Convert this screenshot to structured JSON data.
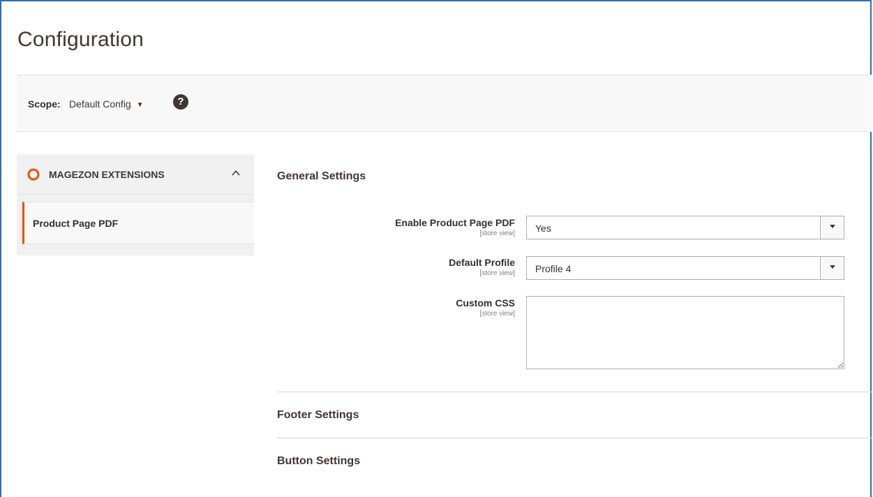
{
  "page": {
    "title": "Configuration"
  },
  "scope": {
    "label": "Scope:",
    "value": "Default Config",
    "help_glyph": "?"
  },
  "sidebar": {
    "group_title": "MAGEZON EXTENSIONS",
    "group_icon": "magezon-logo-icon",
    "items": [
      {
        "label": "Product Page PDF",
        "active": true
      }
    ]
  },
  "sections": {
    "general": {
      "title": "General Settings",
      "fields": {
        "enable": {
          "label": "Enable Product Page PDF",
          "scope_hint": "[store view]",
          "value": "Yes"
        },
        "profile": {
          "label": "Default Profile",
          "scope_hint": "[store view]",
          "value": "Profile 4"
        },
        "custom_css": {
          "label": "Custom CSS",
          "scope_hint": "[store view]",
          "value": ""
        }
      }
    },
    "footer": {
      "title": "Footer Settings"
    },
    "button": {
      "title": "Button Settings"
    }
  },
  "colors": {
    "accent": "#eb5202",
    "frame": "#2a6fb8",
    "text": "#303030",
    "heading": "#41362f"
  }
}
